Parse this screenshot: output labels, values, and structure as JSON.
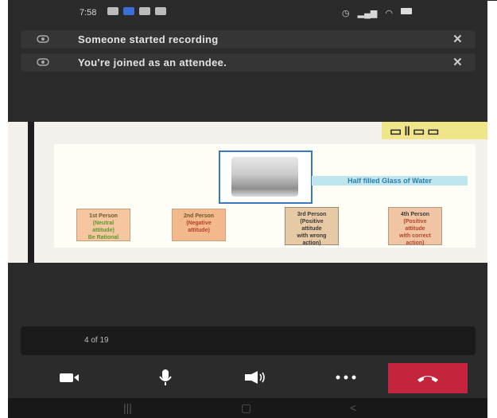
{
  "status": {
    "time": "7:58"
  },
  "notifications": [
    {
      "text": "Someone started recording",
      "icon": "recording-icon",
      "close": "✕"
    },
    {
      "text": "You're joined as an attendee.",
      "icon": "recording-icon",
      "close": "✕"
    }
  ],
  "slide": {
    "caption": "Half filled Glass of Water",
    "persons": [
      {
        "lines": [
          "1st Person",
          "(Neutral",
          "attitude)",
          "Be Rational"
        ]
      },
      {
        "lines": [
          "2nd Person",
          "(Negative",
          "attitude)"
        ]
      },
      {
        "lines": [
          "3rd Person",
          "(Positive",
          "attitude",
          "with wrong",
          "action)"
        ]
      },
      {
        "lines": [
          "4th Person",
          "(Positive",
          "attitude",
          "with correct",
          "action)"
        ]
      }
    ]
  },
  "counter": {
    "text": "4 of 19"
  },
  "controls": {
    "camera": "camera-icon",
    "mic": "microphone-icon",
    "speaker": "speaker-icon",
    "more": "more-icon",
    "end": "end-call-icon"
  },
  "colors": {
    "background": "#2b2b2b",
    "end_call": "#c4253c",
    "logo_bg": "#f1e58a",
    "glass_border": "#3a78c2"
  }
}
